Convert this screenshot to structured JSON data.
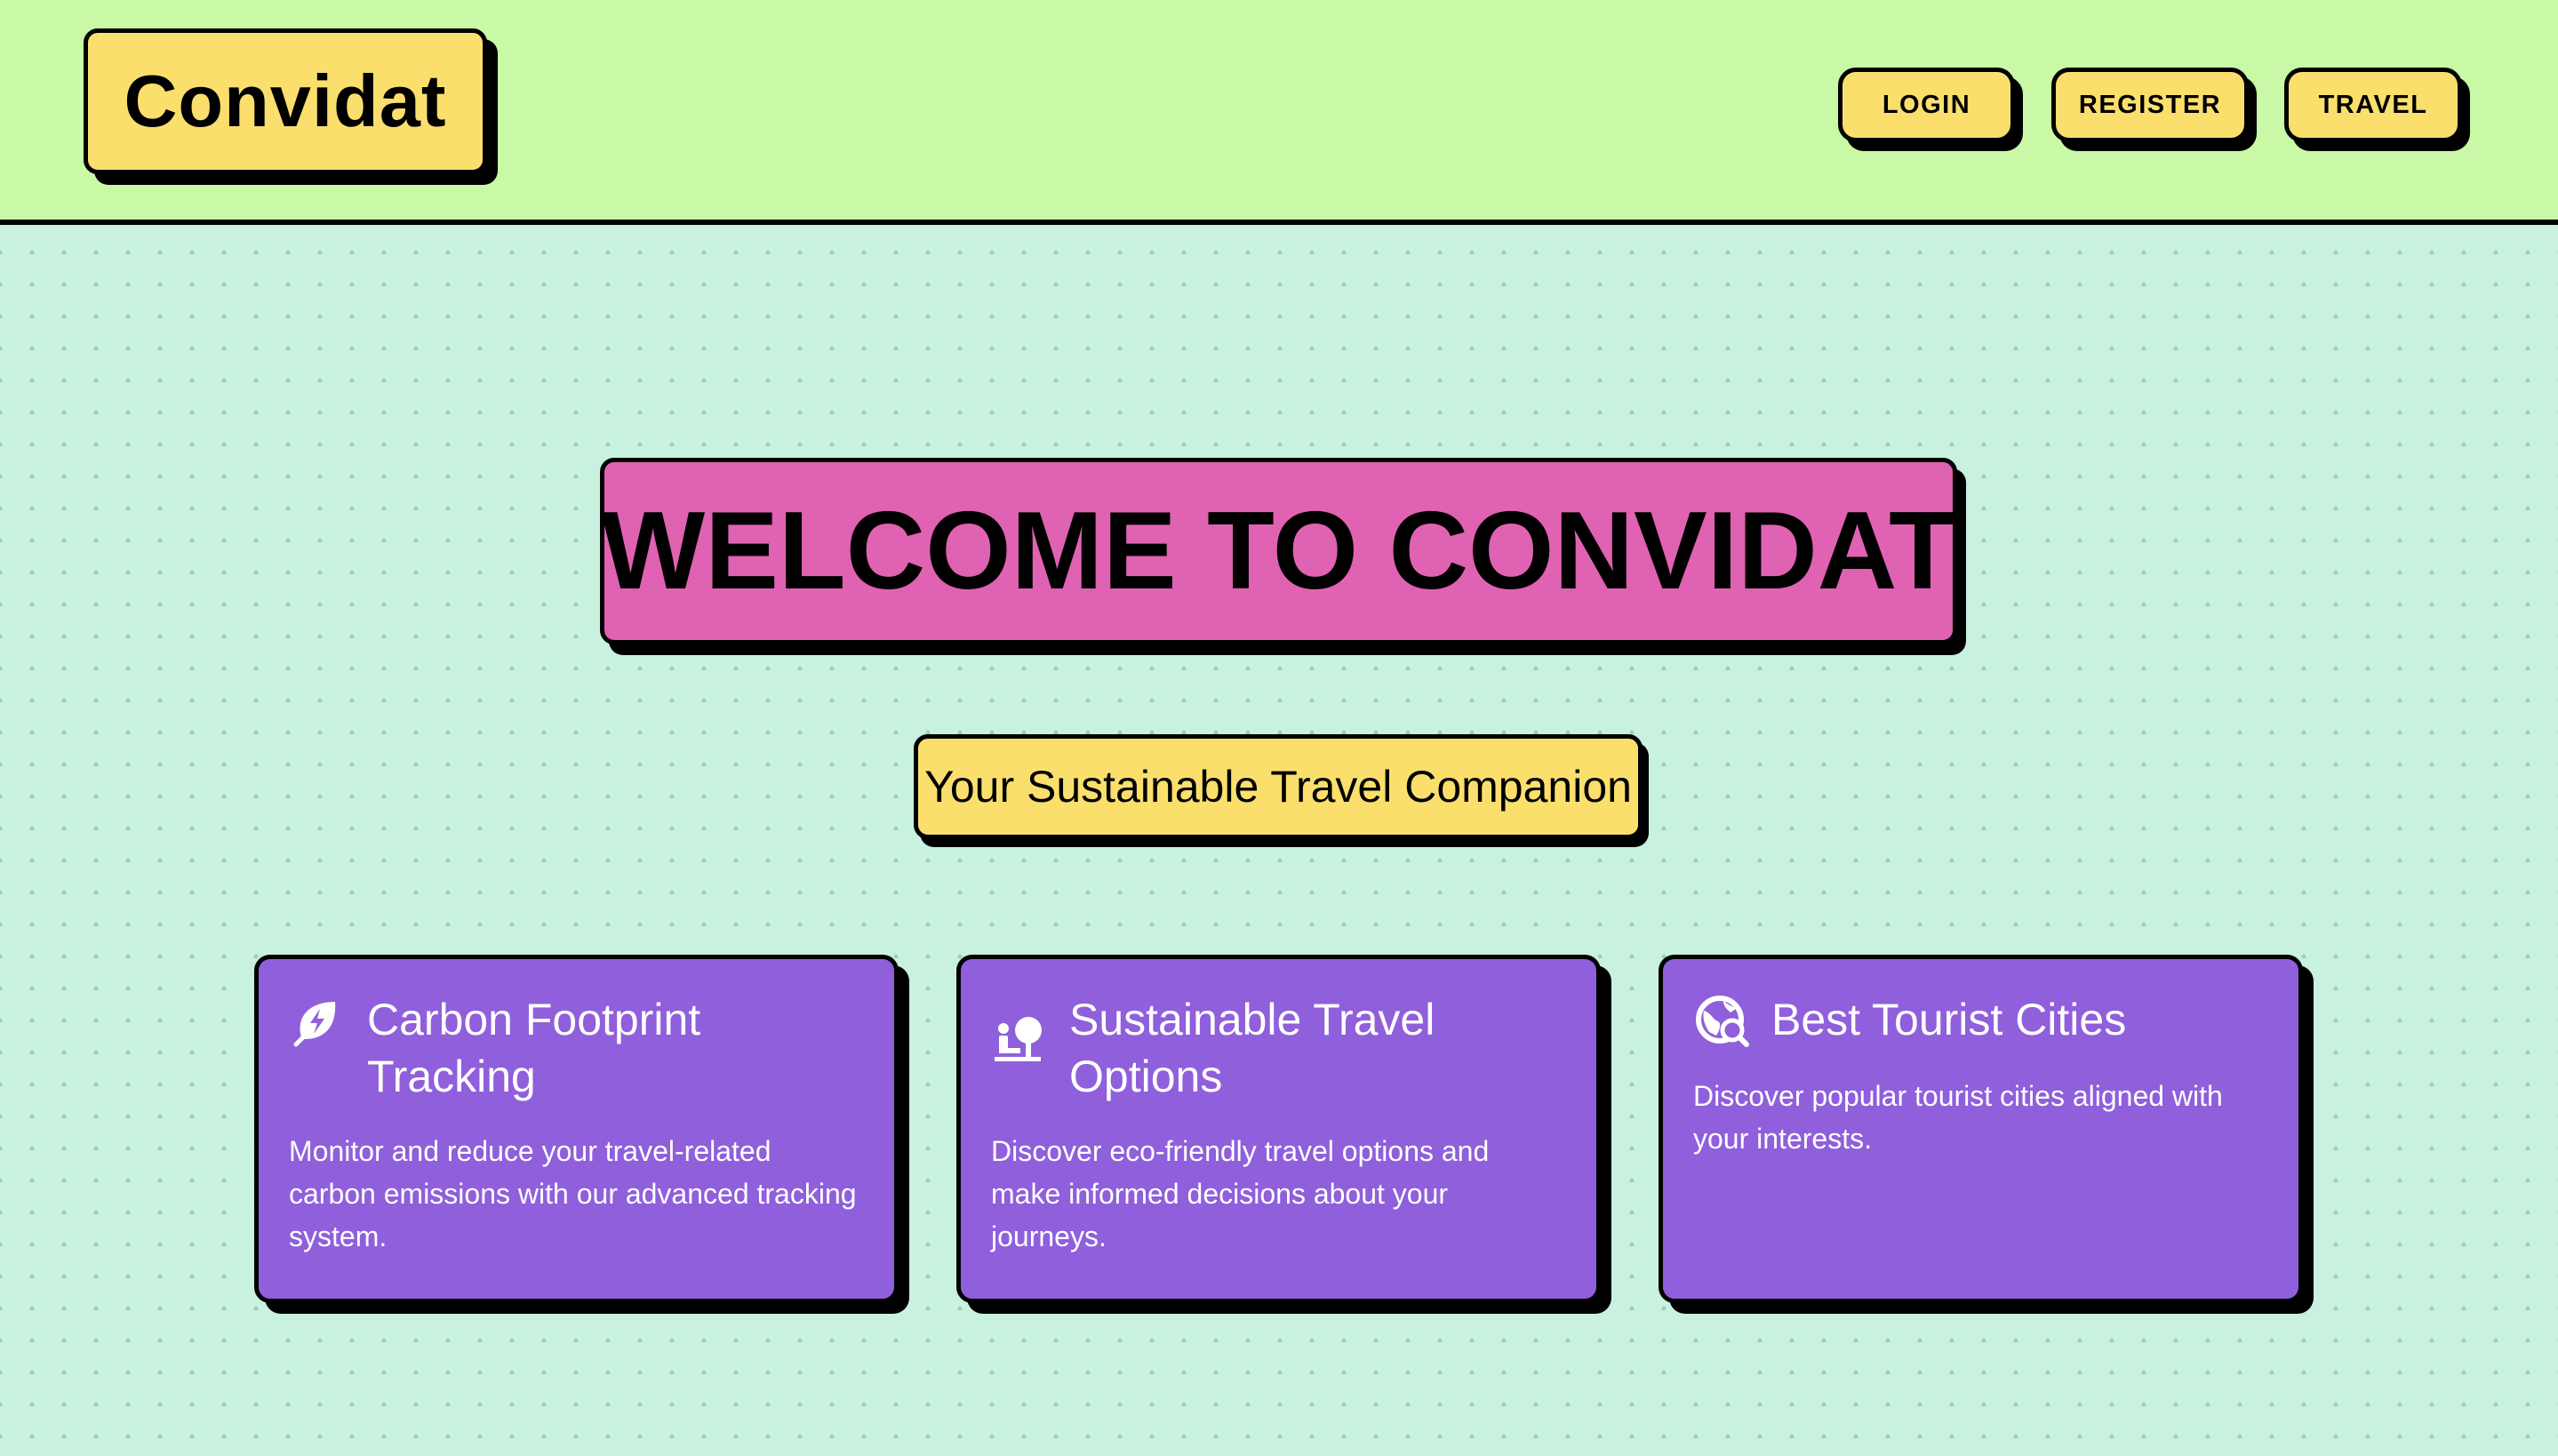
{
  "header": {
    "logo": "Convidat",
    "nav": [
      {
        "label": "LOGIN"
      },
      {
        "label": "REGISTER"
      },
      {
        "label": "TRAVEL"
      }
    ]
  },
  "hero": {
    "title": "WELCOME TO CONVIDAT",
    "subtitle": "Your Sustainable Travel Companion"
  },
  "features": [
    {
      "icon": "eco-leaf-bolt-icon",
      "title": "Carbon Footprint Tracking",
      "description": "Monitor and reduce your travel-related carbon emissions with our advanced tracking system."
    },
    {
      "icon": "person-tree-icon",
      "title": "Sustainable Travel Options",
      "description": "Discover eco-friendly travel options and make informed decisions about your journeys."
    },
    {
      "icon": "globe-search-icon",
      "title": "Best Tourist Cities",
      "description": "Discover popular tourist cities aligned with your interests."
    }
  ],
  "colors": {
    "header_bg": "#c9f9a6",
    "page_bg": "#c8f1e0",
    "accent_yellow": "#fbdf6d",
    "accent_pink": "#e062b2",
    "card_purple": "#8f5fdc",
    "outline": "#000000"
  }
}
